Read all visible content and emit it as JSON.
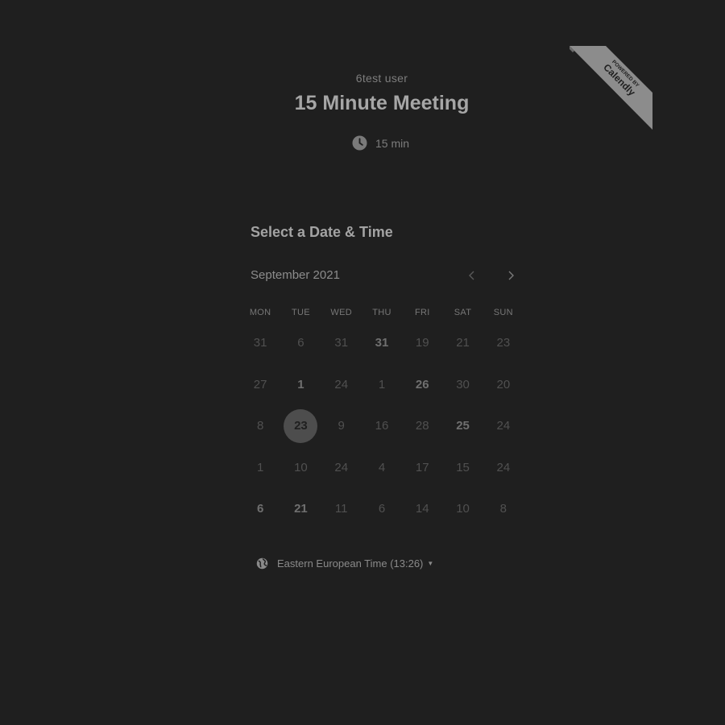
{
  "header": {
    "host_name": "6test user",
    "event_title": "15 Minute Meeting",
    "duration": "15 min",
    "duration_icon": "clock-icon"
  },
  "badge": {
    "line1": "POWERED BY",
    "line2": "Calendly",
    "color": "#8c8c8c"
  },
  "scheduler": {
    "title": "Select a Date & Time",
    "month": "September 2021",
    "prev_icon": "chevron-left-icon",
    "next_icon": "chevron-right-icon",
    "weekdays": [
      "MON",
      "TUE",
      "WED",
      "THU",
      "FRI",
      "SAT",
      "SUN"
    ],
    "weeks": [
      [
        {
          "d": "31",
          "s": "dim"
        },
        {
          "d": "6",
          "s": "dim"
        },
        {
          "d": "31",
          "s": "dim"
        },
        {
          "d": "31",
          "s": "avail"
        },
        {
          "d": "19",
          "s": "dim"
        },
        {
          "d": "21",
          "s": "dim"
        },
        {
          "d": "23",
          "s": "dim"
        }
      ],
      [
        {
          "d": "27",
          "s": "dim"
        },
        {
          "d": "1",
          "s": "avail"
        },
        {
          "d": "24",
          "s": "dim"
        },
        {
          "d": "1",
          "s": "dim"
        },
        {
          "d": "26",
          "s": "avail"
        },
        {
          "d": "30",
          "s": "dim"
        },
        {
          "d": "20",
          "s": "dim"
        }
      ],
      [
        {
          "d": "8",
          "s": "dim"
        },
        {
          "d": "23",
          "s": "selected"
        },
        {
          "d": "9",
          "s": "dim"
        },
        {
          "d": "16",
          "s": "dim"
        },
        {
          "d": "28",
          "s": "dim"
        },
        {
          "d": "25",
          "s": "avail"
        },
        {
          "d": "24",
          "s": "dim"
        }
      ],
      [
        {
          "d": "1",
          "s": "dim"
        },
        {
          "d": "10",
          "s": "dim"
        },
        {
          "d": "24",
          "s": "dim"
        },
        {
          "d": "4",
          "s": "dim"
        },
        {
          "d": "17",
          "s": "dim"
        },
        {
          "d": "15",
          "s": "dim"
        },
        {
          "d": "24",
          "s": "dim"
        }
      ],
      [
        {
          "d": "6",
          "s": "avail"
        },
        {
          "d": "21",
          "s": "avail"
        },
        {
          "d": "11",
          "s": "dim"
        },
        {
          "d": "6",
          "s": "dim"
        },
        {
          "d": "14",
          "s": "dim"
        },
        {
          "d": "10",
          "s": "dim"
        },
        {
          "d": "8",
          "s": "dim"
        }
      ]
    ]
  },
  "timezone": {
    "label": "Eastern European Time (13:26)",
    "icon": "globe-icon"
  },
  "colors": {
    "background": "#1f1f1f",
    "selected_day_bg": "#4d4d4d"
  }
}
